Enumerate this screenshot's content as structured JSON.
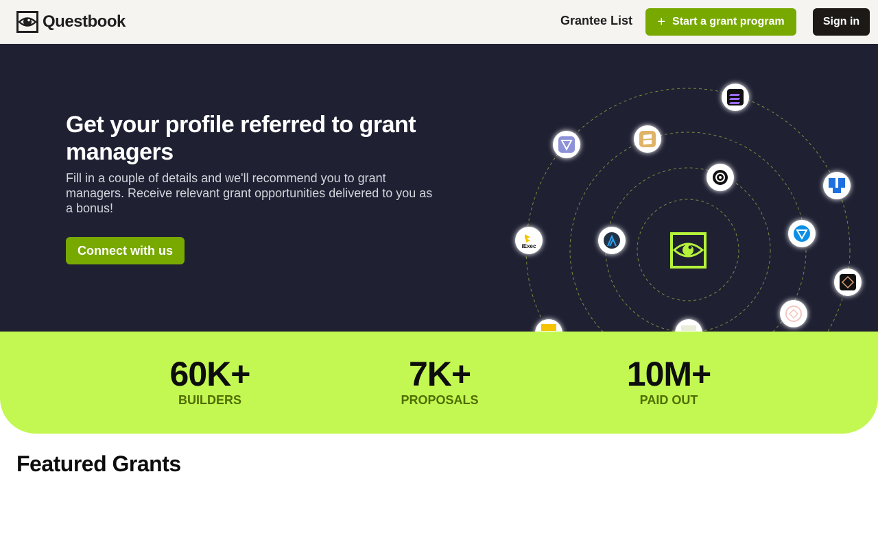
{
  "nav": {
    "logo_text": "Questbook",
    "grantee_list": "Grantee List",
    "start_program_icon": "plus-icon",
    "start_program": "Start a grant program",
    "sign_in": "Sign in"
  },
  "hero": {
    "title": "Get your profile referred to grant managers",
    "subtitle": "Fill in a couple of details and we'll recommend you to grant managers. Receive relevant grant opportunities delivered to you as a bonus!",
    "cta": "Connect with us",
    "center_logo": "questbook-eye-icon",
    "partner_icons": [
      "solana-icon",
      "ton-icon",
      "book-icon",
      "gear-icon",
      "pillar-icon",
      "ton-icon",
      "iexec-icon",
      "arbitrum-icon",
      "aptos-icon",
      "polygon-icon",
      "binance-icon",
      "frame-icon"
    ],
    "iexec_label": "iExec"
  },
  "stats": [
    {
      "value": "60K+",
      "label": "BUILDERS"
    },
    {
      "value": "7K+",
      "label": "PROPOSALS"
    },
    {
      "value": "10M+",
      "label": "PAID OUT"
    }
  ],
  "featured_title": "Featured Grants",
  "colors": {
    "accent_green": "#78a900",
    "lime": "#c3f752",
    "hero_bg": "#1f2133",
    "nav_bg": "#f5f4f0"
  }
}
